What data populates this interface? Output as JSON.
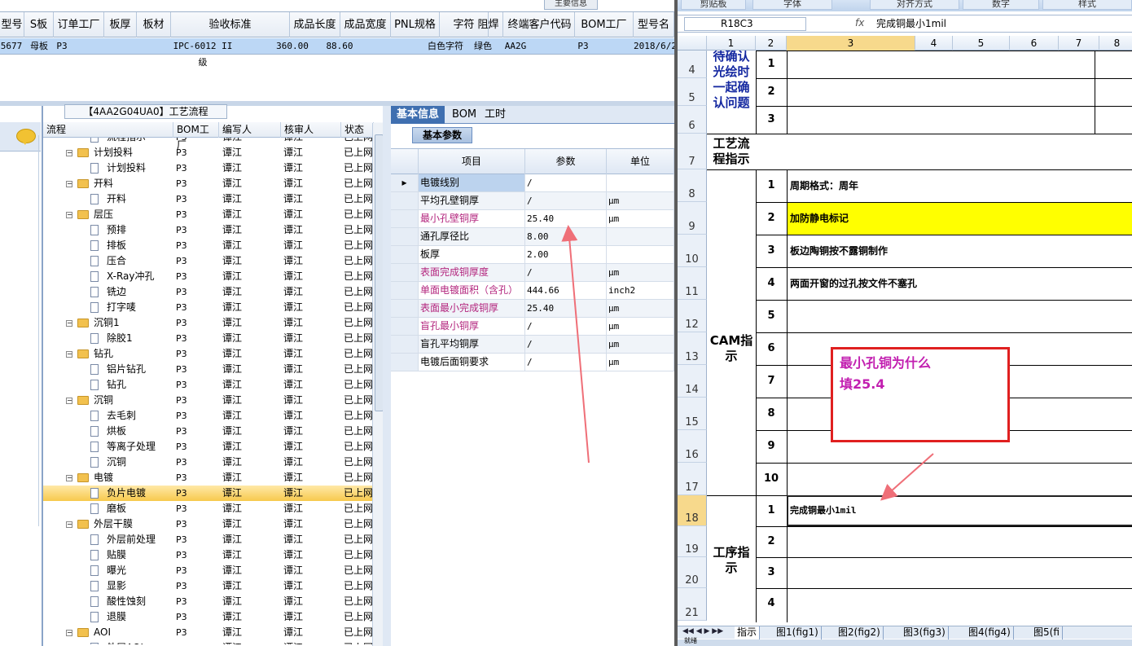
{
  "top_grid": {
    "main_info_tab": "主要信息",
    "columns": [
      "型号",
      "S板",
      "订单工厂",
      "板厚",
      "板材",
      "验收标准",
      "成品长度",
      "成品宽度",
      "PNL规格",
      "字符",
      "阻焊",
      "终端客户代码",
      "BOM工厂",
      "型号名"
    ],
    "row": [
      "5677",
      "母板",
      "P3",
      "",
      "",
      "IPC-6012 II级",
      "360.00",
      "88.60",
      "",
      "白色字符",
      "绿色",
      "AA2G",
      "P3",
      "2018/6/2"
    ]
  },
  "tree": {
    "title": "【4AA2G04UA0】工艺流程",
    "columns": [
      "流程",
      "BOM工厂",
      "编写人",
      "核审人",
      "状态"
    ],
    "rows": [
      {
        "name": "流程指示",
        "level": 2,
        "type": "doc",
        "factory": "P3",
        "author": "谭江",
        "reviewer": "谭江",
        "status": "已上网"
      },
      {
        "name": "计划投料",
        "level": 1,
        "type": "folder",
        "factory": "P3",
        "author": "谭江",
        "reviewer": "谭江",
        "status": "已上网"
      },
      {
        "name": "计划投料",
        "level": 2,
        "type": "doc",
        "factory": "P3",
        "author": "谭江",
        "reviewer": "谭江",
        "status": "已上网"
      },
      {
        "name": "开料",
        "level": 1,
        "type": "folder",
        "factory": "P3",
        "author": "谭江",
        "reviewer": "谭江",
        "status": "已上网"
      },
      {
        "name": "开料",
        "level": 2,
        "type": "doc",
        "factory": "P3",
        "author": "谭江",
        "reviewer": "谭江",
        "status": "已上网"
      },
      {
        "name": "层压",
        "level": 1,
        "type": "folder",
        "factory": "P3",
        "author": "谭江",
        "reviewer": "谭江",
        "status": "已上网"
      },
      {
        "name": "预排",
        "level": 2,
        "type": "doc",
        "factory": "P3",
        "author": "谭江",
        "reviewer": "谭江",
        "status": "已上网"
      },
      {
        "name": "排板",
        "level": 2,
        "type": "doc",
        "factory": "P3",
        "author": "谭江",
        "reviewer": "谭江",
        "status": "已上网"
      },
      {
        "name": "压合",
        "level": 2,
        "type": "doc",
        "factory": "P3",
        "author": "谭江",
        "reviewer": "谭江",
        "status": "已上网"
      },
      {
        "name": "X-Ray冲孔",
        "level": 2,
        "type": "doc",
        "factory": "P3",
        "author": "谭江",
        "reviewer": "谭江",
        "status": "已上网"
      },
      {
        "name": "铣边",
        "level": 2,
        "type": "doc",
        "factory": "P3",
        "author": "谭江",
        "reviewer": "谭江",
        "status": "已上网"
      },
      {
        "name": "打字唛",
        "level": 2,
        "type": "doc",
        "factory": "P3",
        "author": "谭江",
        "reviewer": "谭江",
        "status": "已上网"
      },
      {
        "name": "沉铜1",
        "level": 1,
        "type": "folder",
        "factory": "P3",
        "author": "谭江",
        "reviewer": "谭江",
        "status": "已上网"
      },
      {
        "name": "除胶1",
        "level": 2,
        "type": "doc",
        "factory": "P3",
        "author": "谭江",
        "reviewer": "谭江",
        "status": "已上网"
      },
      {
        "name": "钻孔",
        "level": 1,
        "type": "folder",
        "factory": "P3",
        "author": "谭江",
        "reviewer": "谭江",
        "status": "已上网"
      },
      {
        "name": "铝片钻孔",
        "level": 2,
        "type": "doc",
        "factory": "P3",
        "author": "谭江",
        "reviewer": "谭江",
        "status": "已上网"
      },
      {
        "name": "钻孔",
        "level": 2,
        "type": "doc",
        "factory": "P3",
        "author": "谭江",
        "reviewer": "谭江",
        "status": "已上网"
      },
      {
        "name": "沉铜",
        "level": 1,
        "type": "folder",
        "factory": "P3",
        "author": "谭江",
        "reviewer": "谭江",
        "status": "已上网"
      },
      {
        "name": "去毛刺",
        "level": 2,
        "type": "doc",
        "factory": "P3",
        "author": "谭江",
        "reviewer": "谭江",
        "status": "已上网"
      },
      {
        "name": "烘板",
        "level": 2,
        "type": "doc",
        "factory": "P3",
        "author": "谭江",
        "reviewer": "谭江",
        "status": "已上网"
      },
      {
        "name": "等离子处理",
        "level": 2,
        "type": "doc",
        "factory": "P3",
        "author": "谭江",
        "reviewer": "谭江",
        "status": "已上网"
      },
      {
        "name": "沉铜",
        "level": 2,
        "type": "doc",
        "factory": "P3",
        "author": "谭江",
        "reviewer": "谭江",
        "status": "已上网"
      },
      {
        "name": "电镀",
        "level": 1,
        "type": "folder",
        "factory": "P3",
        "author": "谭江",
        "reviewer": "谭江",
        "status": "已上网"
      },
      {
        "name": "负片电镀",
        "level": 2,
        "type": "doc",
        "factory": "P3",
        "author": "谭江",
        "reviewer": "谭江",
        "status": "已上网",
        "selected": true
      },
      {
        "name": "磨板",
        "level": 2,
        "type": "doc",
        "factory": "P3",
        "author": "谭江",
        "reviewer": "谭江",
        "status": "已上网"
      },
      {
        "name": "外层干膜",
        "level": 1,
        "type": "folder",
        "factory": "P3",
        "author": "谭江",
        "reviewer": "谭江",
        "status": "已上网"
      },
      {
        "name": "外层前处理",
        "level": 2,
        "type": "doc",
        "factory": "P3",
        "author": "谭江",
        "reviewer": "谭江",
        "status": "已上网"
      },
      {
        "name": "贴膜",
        "level": 2,
        "type": "doc",
        "factory": "P3",
        "author": "谭江",
        "reviewer": "谭江",
        "status": "已上网"
      },
      {
        "name": "曝光",
        "level": 2,
        "type": "doc",
        "factory": "P3",
        "author": "谭江",
        "reviewer": "谭江",
        "status": "已上网"
      },
      {
        "name": "显影",
        "level": 2,
        "type": "doc",
        "factory": "P3",
        "author": "谭江",
        "reviewer": "谭江",
        "status": "已上网"
      },
      {
        "name": "酸性蚀刻",
        "level": 2,
        "type": "doc",
        "factory": "P3",
        "author": "谭江",
        "reviewer": "谭江",
        "status": "已上网"
      },
      {
        "name": "退膜",
        "level": 2,
        "type": "doc",
        "factory": "P3",
        "author": "谭江",
        "reviewer": "谭江",
        "status": "已上网"
      },
      {
        "name": "AOI",
        "level": 1,
        "type": "folder",
        "factory": "P3",
        "author": "谭江",
        "reviewer": "谭江",
        "status": "已上网"
      },
      {
        "name": "外层AOI",
        "level": 2,
        "type": "doc",
        "factory": "P3",
        "author": "谭江",
        "reviewer": "谭江",
        "status": "已上网"
      }
    ]
  },
  "info": {
    "tabs": [
      "基本信息",
      "BOM",
      "工时"
    ],
    "subtab": "基本参数",
    "columns": [
      "项目",
      "参数",
      "单位"
    ],
    "rows": [
      {
        "item": "电镀线别",
        "value": "/",
        "unit": "",
        "magenta": false
      },
      {
        "item": "平均孔壁铜厚",
        "value": "/",
        "unit": "μm",
        "magenta": false
      },
      {
        "item": "最小孔壁铜厚",
        "value": "25.40",
        "unit": "μm",
        "magenta": true
      },
      {
        "item": "通孔厚径比",
        "value": "8.00",
        "unit": "",
        "magenta": false
      },
      {
        "item": "板厚",
        "value": "2.00",
        "unit": "",
        "magenta": false
      },
      {
        "item": "表面完成铜厚度",
        "value": "/",
        "unit": "μm",
        "magenta": true
      },
      {
        "item": "单面电镀面积（含孔）",
        "value": "444.66",
        "unit": "inch2",
        "magenta": true
      },
      {
        "item": "表面最小完成铜厚",
        "value": "25.40",
        "unit": "μm",
        "magenta": true
      },
      {
        "item": "盲孔最小铜厚",
        "value": "/",
        "unit": "μm",
        "magenta": true
      },
      {
        "item": "盲孔平均铜厚",
        "value": "/",
        "unit": "μm",
        "magenta": false
      },
      {
        "item": "电镀后面铜要求",
        "value": "/",
        "unit": "μm",
        "magenta": false
      }
    ]
  },
  "excel": {
    "ribbon_groups": [
      "剪贴板",
      "字体",
      "对齐方式",
      "数字",
      "样式"
    ],
    "name_box": "R18C3",
    "fx": "fx",
    "formula": "完成铜最小1mil",
    "col_headers": [
      "1",
      "2",
      "3",
      "4",
      "5",
      "6",
      "7",
      "8"
    ],
    "row_numbers": [
      "4",
      "5",
      "6",
      "7",
      "8",
      "9",
      "10",
      "11",
      "12",
      "13",
      "14",
      "15",
      "16",
      "17",
      "18",
      "19",
      "20",
      "21"
    ],
    "confirm_label": "待确认光绘时一起确认问题",
    "flow_label": "工艺流程指示",
    "cam_label": "CAM指示",
    "proc_label": "工序指示",
    "confirm_nums": [
      "1",
      "2",
      "3"
    ],
    "cam_nums": [
      "1",
      "2",
      "3",
      "4",
      "5",
      "6",
      "7",
      "8",
      "9",
      "10"
    ],
    "cam_texts": [
      "周期格式：周年",
      "加防静电标记",
      "板边陶铜按不露铜制作",
      "两面开窗的过孔按文件不塞孔"
    ],
    "proc_nums": [
      "1",
      "2",
      "3",
      "4"
    ],
    "proc_text": "完成铜最小1mil",
    "sheet_tabs": [
      "指示",
      "图1(fig1)",
      "图2(fig2)",
      "图3(fig3)",
      "图4(fig4)",
      "图5(fi"
    ],
    "status": "就绪",
    "highlight_color": "#ffff00"
  },
  "annotation": {
    "line1": "最小孔铜为什么",
    "line2": "填25.4",
    "color": "#c21fb0",
    "border_color": "#e02020"
  }
}
